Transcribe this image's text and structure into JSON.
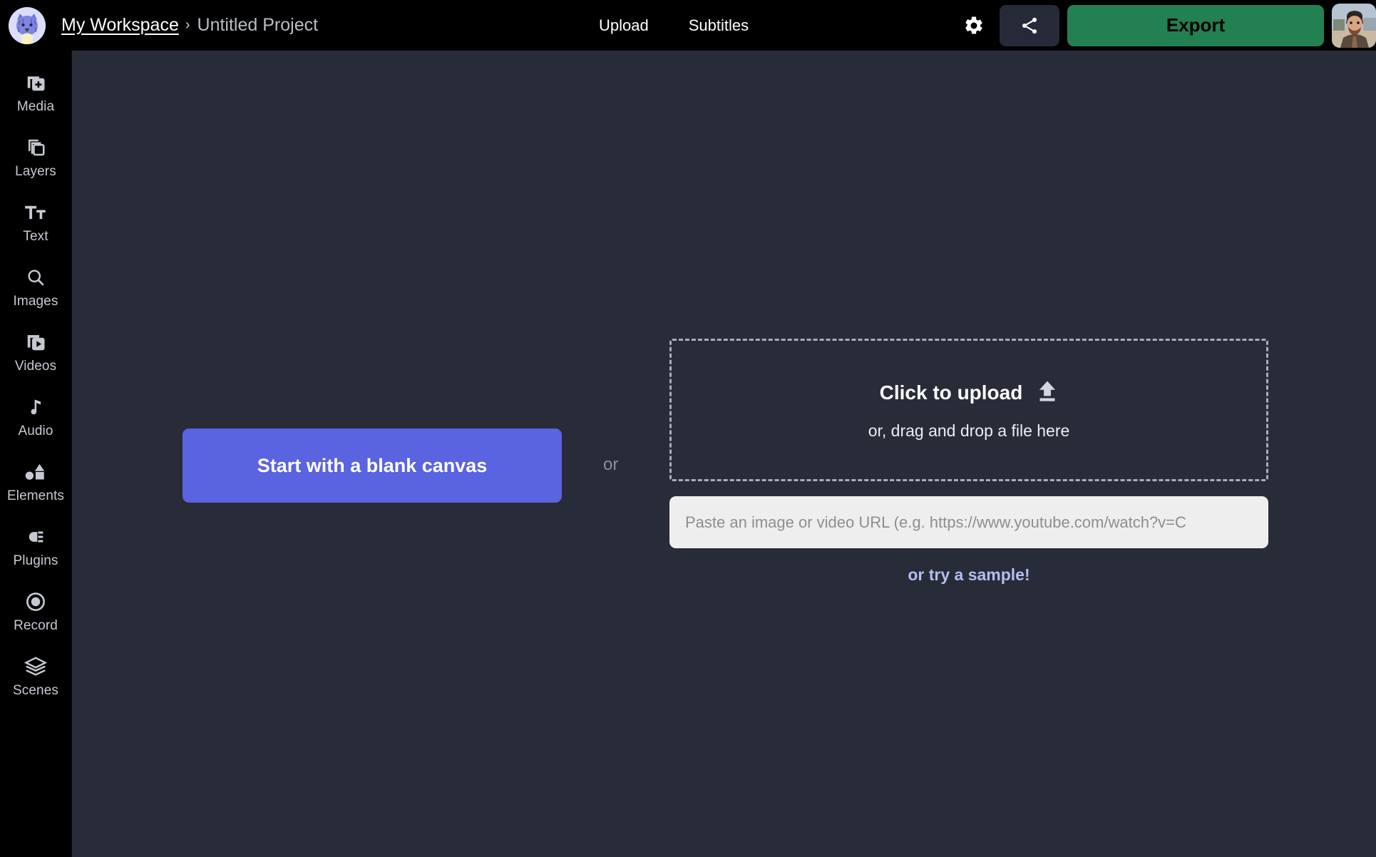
{
  "header": {
    "workspace_label": "My Workspace",
    "breadcrumb_separator": "›",
    "project_title": "Untitled Project",
    "nav": [
      {
        "label": "Upload",
        "name": "upload"
      },
      {
        "label": "Subtitles",
        "name": "subtitles"
      }
    ],
    "gear_icon": "gear-icon",
    "share_icon": "share-icon",
    "export_label": "Export",
    "export_color": "#238053",
    "workspace_avatar_icon": "cat-avatar",
    "user_avatar_icon": "user-photo-avatar"
  },
  "sidebar": {
    "items": [
      {
        "label": "Media",
        "icon": "media-add-icon"
      },
      {
        "label": "Layers",
        "icon": "layers-stack-icon"
      },
      {
        "label": "Text",
        "icon": "text-format-icon"
      },
      {
        "label": "Images",
        "icon": "search-icon"
      },
      {
        "label": "Videos",
        "icon": "video-play-icon"
      },
      {
        "label": "Audio",
        "icon": "music-note-icon"
      },
      {
        "label": "Elements",
        "icon": "shapes-icon"
      },
      {
        "label": "Plugins",
        "icon": "plug-icon"
      },
      {
        "label": "Record",
        "icon": "record-circle-icon"
      },
      {
        "label": "Scenes",
        "icon": "scenes-layers-icon"
      }
    ]
  },
  "main": {
    "blank_canvas_label": "Start with a blank canvas",
    "blank_canvas_color": "#5a63e0",
    "or_separator": "or",
    "upload_title": "Click to upload",
    "upload_icon": "upload-arrow-icon",
    "upload_subtitle": "or, drag and drop a file here",
    "url_placeholder": "Paste an image or video URL (e.g. https://www.youtube.com/watch?v=C",
    "url_value": "",
    "sample_link_label": "or try a sample!",
    "sample_link_color": "#b4bdf0",
    "canvas_background": "#282b38"
  }
}
